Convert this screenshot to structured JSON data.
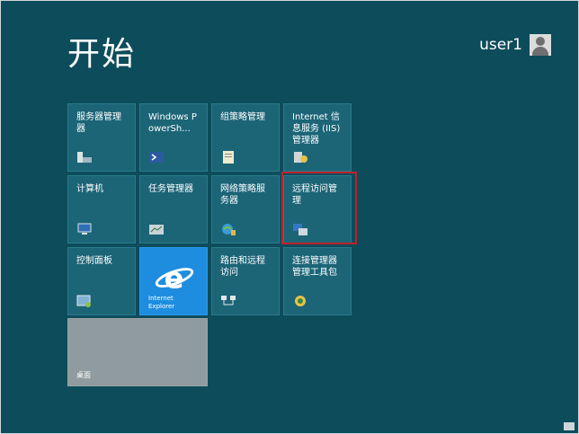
{
  "start": {
    "title": "开始"
  },
  "user": {
    "name": "user1",
    "avatar_icon": "user-avatar-icon"
  },
  "tiles": [
    {
      "label": "服务器管理器",
      "icon": "server-manager-icon"
    },
    {
      "label": "Windows PowerSh...",
      "icon": "powershell-icon"
    },
    {
      "label": "组策略管理",
      "icon": "group-policy-icon"
    },
    {
      "label": "Internet 信息服务 (IIS)管理器",
      "icon": "iis-icon"
    },
    {
      "label": "计算机",
      "icon": "computer-icon"
    },
    {
      "label": "任务管理器",
      "icon": "task-manager-icon"
    },
    {
      "label": "网络策略服务器",
      "icon": "network-policy-icon"
    },
    {
      "label": "远程访问管理",
      "icon": "remote-access-icon"
    },
    {
      "label": "控制面板",
      "icon": "control-panel-icon"
    },
    {
      "label": "Internet Explorer",
      "icon": "internet-explorer-icon"
    },
    {
      "label": "路由和远程访问",
      "icon": "routing-icon"
    },
    {
      "label": "连接管理器管理工具包",
      "icon": "connection-manager-icon"
    },
    {
      "label": "桌面",
      "icon": "desktop-icon"
    }
  ],
  "colors": {
    "background": "#0d4c5b",
    "tile": "#1b6577",
    "ie_tile": "#1e8de0",
    "desktop_tile": "#8f9b9e",
    "highlight": "#c0202a"
  }
}
